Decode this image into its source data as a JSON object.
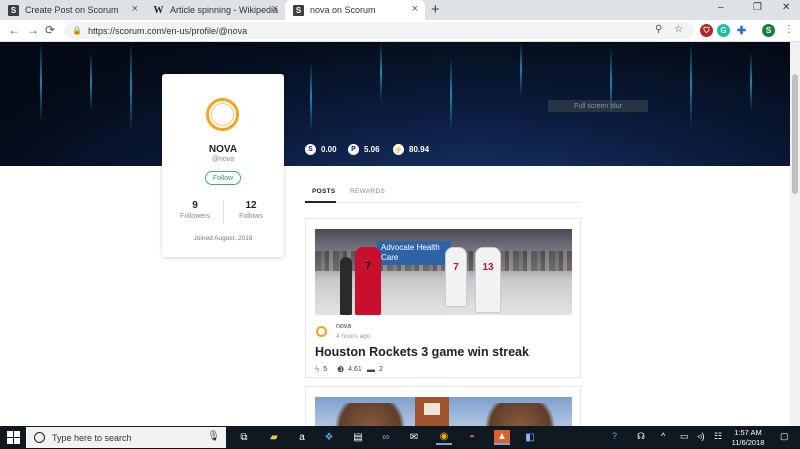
{
  "browser": {
    "tabs": [
      {
        "title": "Create Post on Scorum",
        "favicon": "S"
      },
      {
        "title": "Article spinning - Wikipedia",
        "favicon": "W"
      },
      {
        "title": "nova on Scorum",
        "favicon": "S"
      }
    ],
    "active_tab": 2,
    "new_tab_glyph": "+",
    "close_glyph": "×",
    "window_controls": {
      "minimize": "–",
      "maximize": "❐",
      "close": "✕"
    },
    "url": "https://scorum.com/en-us/profile/@nova",
    "nav": {
      "back": "←",
      "forward": "→",
      "reload": "⟳"
    },
    "extension_avatar_letter": "S"
  },
  "banner": {
    "fullscreen_label": "Full screen blur",
    "stats": [
      {
        "icon": "S",
        "value": "0.00"
      },
      {
        "icon": "P",
        "value": "5.06"
      },
      {
        "icon": "⚡",
        "value": "80.94"
      }
    ]
  },
  "profile": {
    "name": "NOVA",
    "handle": "@nova",
    "follow_label": "Follow",
    "followers_count": "9",
    "followers_label": "Followers",
    "following_count": "12",
    "following_label": "Follows",
    "joined": "Joined August, 2018"
  },
  "content_tabs": [
    {
      "label": "POSTS",
      "active": true
    },
    {
      "label": "REWARDS",
      "active": false
    }
  ],
  "post": {
    "image_sign_text": "Advocate Health Care",
    "jersey_numbers": [
      "7",
      "7",
      "13"
    ],
    "author": "nova",
    "time": "4 hours ago",
    "title": "Houston Rockets 3 game win streak",
    "votes": "5",
    "reward": "4.61",
    "comments": "2"
  },
  "taskbar": {
    "search_placeholder": "Type here to search",
    "time": "1:57 AM",
    "date": "11/6/2018"
  },
  "colors": {
    "accent_green": "#3cb371",
    "avatar_ring": "#f4a51c",
    "taskbar": "#101820"
  }
}
